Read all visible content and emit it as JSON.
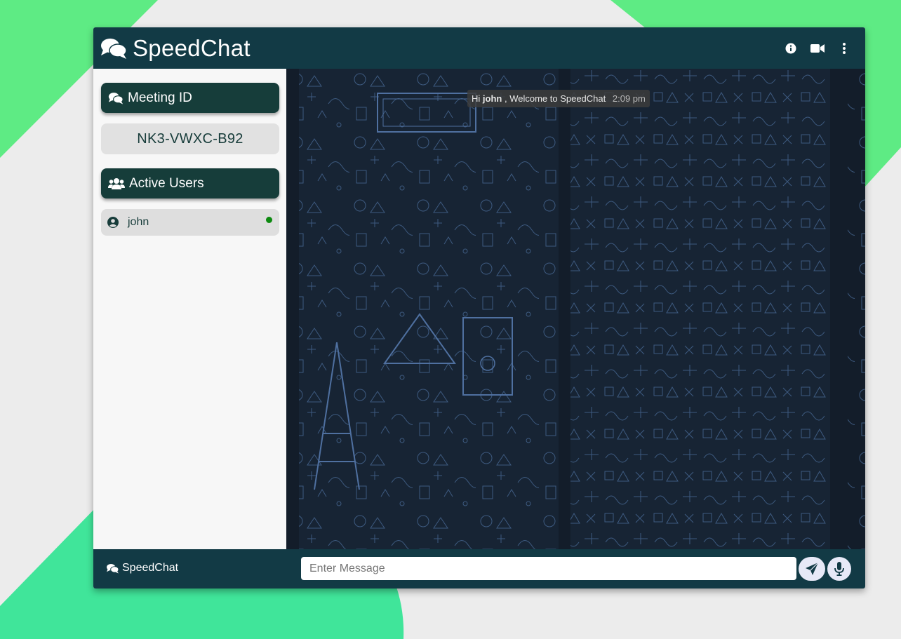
{
  "app": {
    "title": "SpeedChat"
  },
  "header": {
    "icons": [
      "info-icon",
      "video-camera-icon",
      "more-vertical-icon"
    ]
  },
  "sidebar": {
    "meeting_label": "Meeting ID",
    "meeting_id": "NK3-VWXC-B92",
    "users_label": "Active Users",
    "users": [
      {
        "name": "john",
        "status": "online"
      }
    ]
  },
  "chat": {
    "messages": [
      {
        "greeting": "Hi",
        "user": "john",
        "text": ", Welcome to SpeedChat",
        "time": "2:09 pm"
      }
    ]
  },
  "footer": {
    "brand": "SpeedChat",
    "input_placeholder": "Enter Message"
  },
  "colors": {
    "header": "#123a45",
    "section_button": "#163d3a",
    "online": "#0d8a10",
    "background_accent": "#5eeb84"
  }
}
